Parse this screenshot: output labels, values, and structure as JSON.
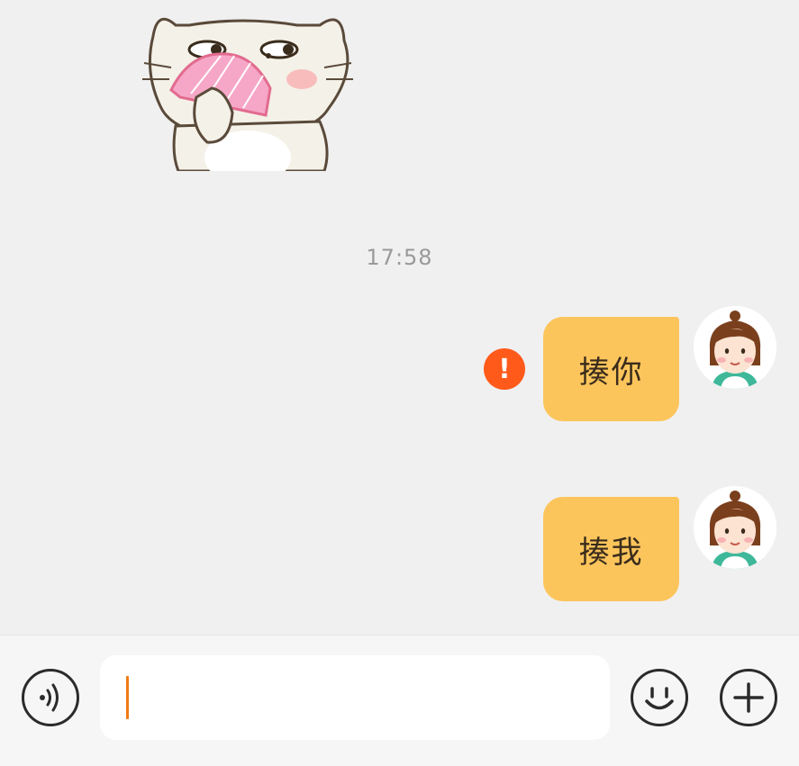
{
  "chat": {
    "timestamp": "17:58",
    "messages": [
      {
        "text": "揍你",
        "status": "failed",
        "status_icon": "error-icon"
      },
      {
        "text": "揍我",
        "status": "sent"
      }
    ],
    "sticker": {
      "icon": "cat-with-fan-sticker"
    },
    "avatar_icon": "girl-avatar-icon"
  },
  "input_bar": {
    "value": "",
    "placeholder": "",
    "voice_icon": "voice-icon",
    "emoji_icon": "emoji-icon",
    "plus_icon": "plus-icon"
  },
  "colors": {
    "bubble": "#fcc55c",
    "error": "#ff5a1a",
    "caret": "#f07a14",
    "background": "#f0f0f0"
  }
}
